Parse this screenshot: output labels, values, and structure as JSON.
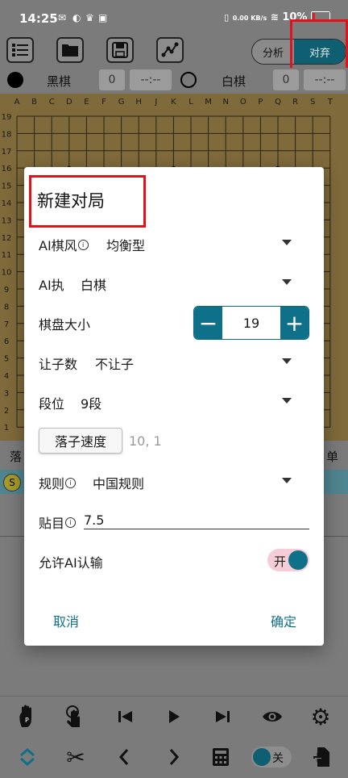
{
  "status": {
    "time": "14:25",
    "net_speed": "0.00 KB/s",
    "battery": "10%"
  },
  "toolbar": {
    "analyze_label": "分析",
    "resign_label": "对弃"
  },
  "players": {
    "black": {
      "name": "黑棋",
      "captures": "0",
      "time": "--:--"
    },
    "white": {
      "name": "白棋",
      "captures": "0",
      "time": "--:--"
    }
  },
  "board": {
    "columns": [
      "A",
      "B",
      "C",
      "D",
      "E",
      "F",
      "G",
      "H",
      "J",
      "K",
      "L",
      "M",
      "N",
      "O",
      "P",
      "Q",
      "R",
      "S",
      "T"
    ],
    "rows": [
      "19",
      "18",
      "17",
      "16",
      "15",
      "14",
      "13",
      "12",
      "11",
      "10",
      "9",
      "8",
      "7",
      "6",
      "5",
      "4",
      "3",
      "2",
      "1"
    ]
  },
  "below_board": {
    "left_text": "落",
    "right_text": "单",
    "badge": "S"
  },
  "dialog": {
    "title": "新建对局",
    "ai_style": {
      "label": "AI棋风",
      "value": "均衡型"
    },
    "ai_side": {
      "label": "AI执",
      "value": "白棋"
    },
    "board_size": {
      "label": "棋盘大小",
      "value": "19",
      "minus": "−",
      "plus": "+"
    },
    "handicap": {
      "label": "让子数",
      "value": "不让子"
    },
    "rank": {
      "label": "段位",
      "value": "9段"
    },
    "speed": {
      "button": "落子速度",
      "value": "10, 1"
    },
    "rules": {
      "label": "规则",
      "value": "中国规则"
    },
    "komi": {
      "label": "贴目",
      "value": "7.5"
    },
    "allow_resign": {
      "label": "允许AI认输",
      "toggle": "开"
    },
    "cancel": "取消",
    "confirm": "确定"
  },
  "bottom": {
    "toggle_label": "关"
  },
  "colors": {
    "accent": "#0f7089",
    "highlight": "#e0121b",
    "board": "#7f6a3b"
  }
}
